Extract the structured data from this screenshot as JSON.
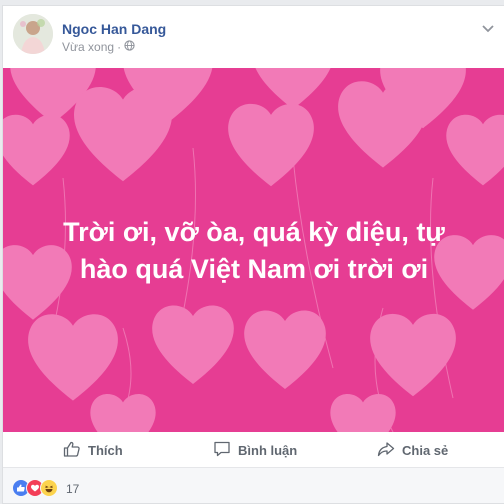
{
  "post": {
    "author": "Ngoc Han Dang",
    "timestamp": "Vừa xong",
    "separator": "·",
    "privacy_icon": "globe-icon",
    "menu_icon": "chevron-down-icon"
  },
  "banner": {
    "line1": "Trời ơi, vỡ òa, quá kỳ diệu, tự",
    "line2": "hào quá Việt Nam ơi trời ơi",
    "background_color": "#e63d93",
    "heart_color": "#f27ab7",
    "text_color": "#ffffff"
  },
  "actions": {
    "like_label": "Thích",
    "comment_label": "Bình luận",
    "share_label": "Chia sẻ"
  },
  "reactions": {
    "types": [
      "like",
      "love",
      "haha"
    ],
    "count": "17"
  },
  "colors": {
    "link_blue": "#365899",
    "meta_gray": "#90949c",
    "action_gray": "#606770"
  }
}
